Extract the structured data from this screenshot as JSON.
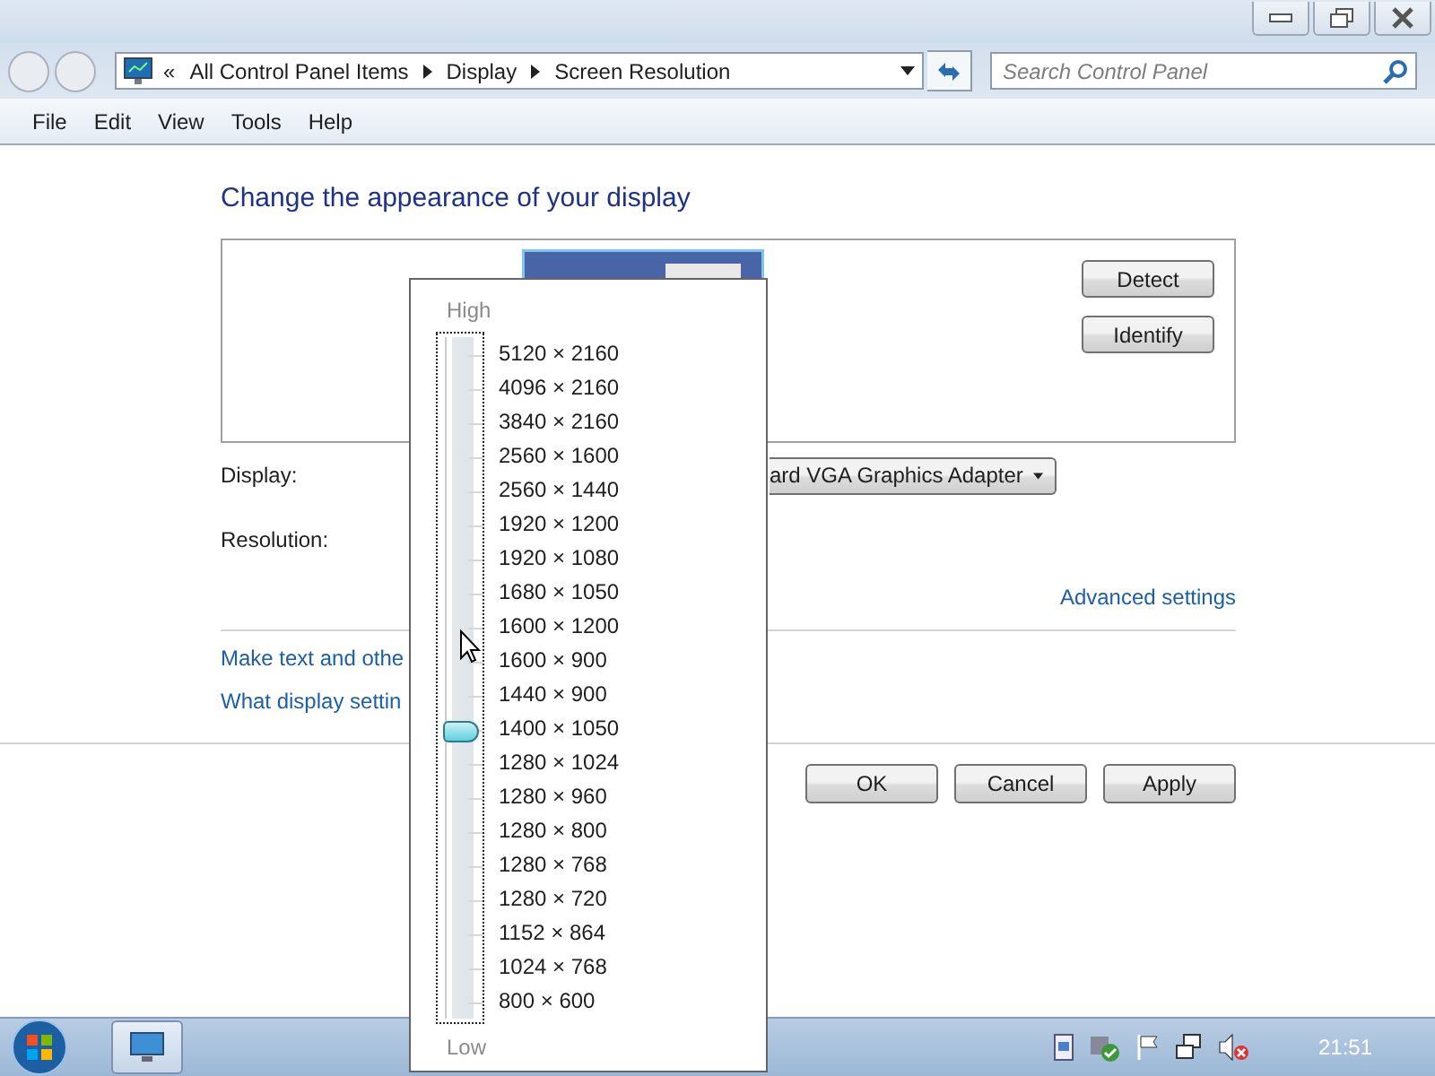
{
  "address_bar": {
    "overflow": "«",
    "breadcrumbs": [
      "All Control Panel Items",
      "Display",
      "Screen Resolution"
    ]
  },
  "search": {
    "placeholder": "Search Control Panel"
  },
  "menu": [
    "File",
    "Edit",
    "View",
    "Tools",
    "Help"
  ],
  "heading": "Change the appearance of your display",
  "preview": {
    "buttons": [
      "Detect",
      "Identify"
    ]
  },
  "display": {
    "label": "Display:",
    "value": "ard VGA Graphics Adapter"
  },
  "resolution": {
    "label": "Resolution:"
  },
  "advanced_link": "Advanced settings",
  "links": [
    "Make text and othe",
    "What display settin"
  ],
  "buttons": [
    "OK",
    "Cancel",
    "Apply"
  ],
  "resolution_popup": {
    "high": "High",
    "low": "Low",
    "level": 0.42,
    "options": [
      "5120 × 2160",
      "4096 × 2160",
      "3840 × 2160",
      "2560 × 1600",
      "2560 × 1440",
      "1920 × 1200",
      "1920 × 1080",
      "1680 × 1050",
      "1600 × 1200",
      "1600 × 900",
      "1440 × 900",
      "1400 × 1050",
      "1280 × 1024",
      "1280 × 960",
      "1280 × 800",
      "1280 × 768",
      "1280 × 720",
      "1152 × 864",
      "1024 × 768",
      "800 × 600"
    ]
  },
  "taskbar": {
    "clock": "21:51"
  }
}
